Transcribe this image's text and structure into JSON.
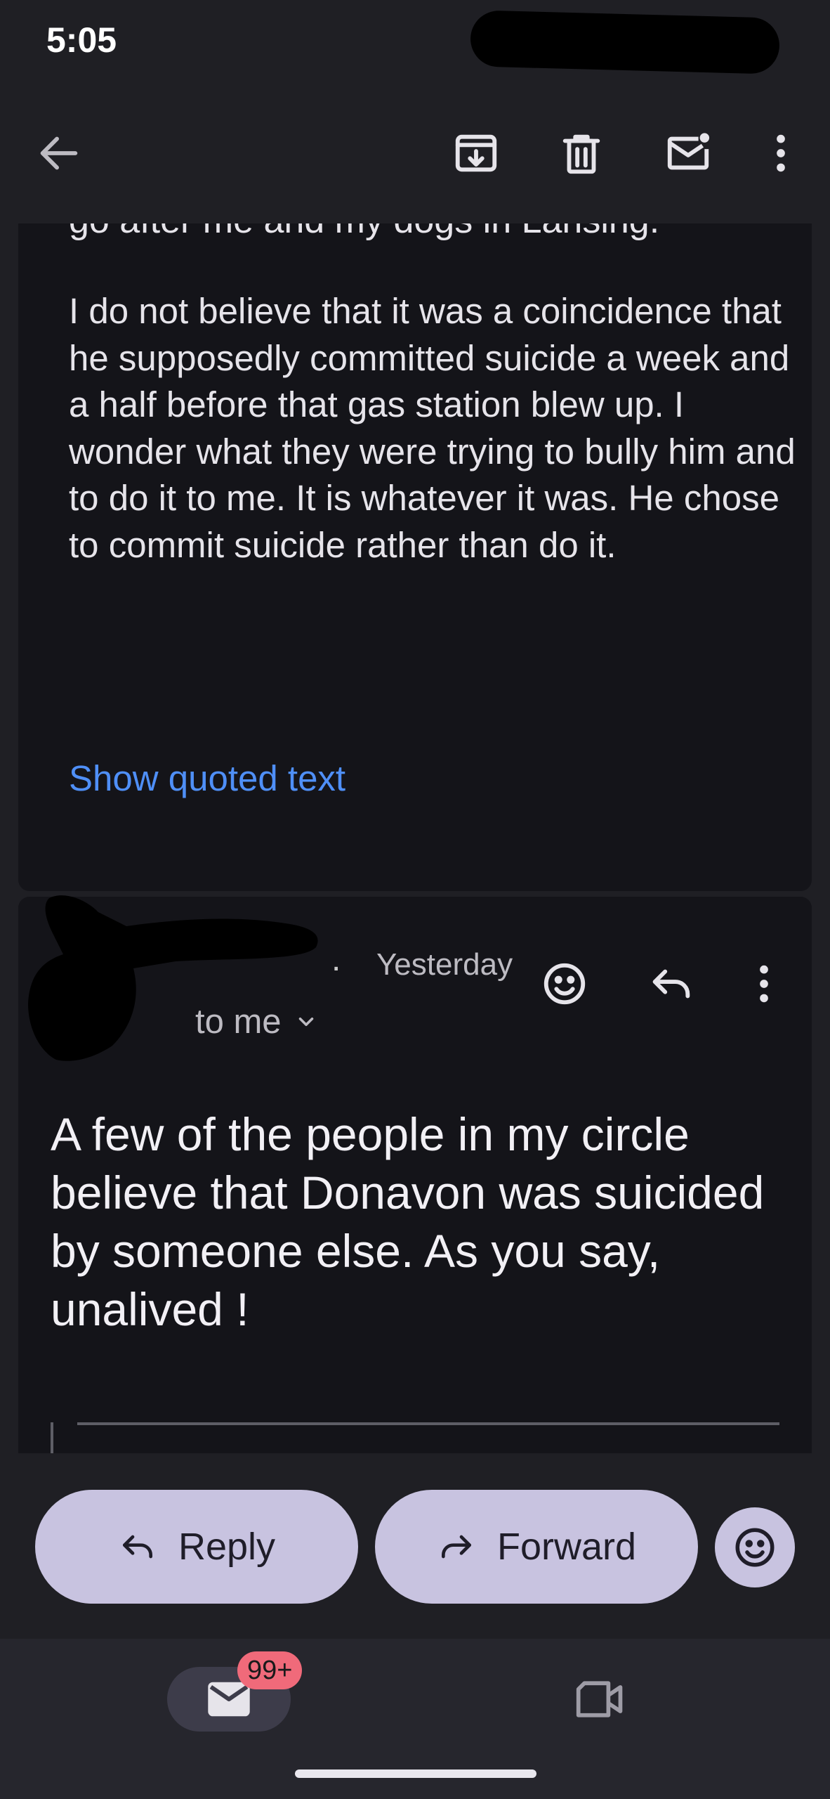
{
  "status_bar": {
    "time": "5:05"
  },
  "toolbar": {
    "back_icon": "arrow-left-icon",
    "archive_icon": "archive-icon",
    "delete_icon": "trash-icon",
    "mark_unread_icon": "mail-unread-icon",
    "more_icon": "more-vert-icon"
  },
  "first_message": {
    "cutoff_text": "go after me and my dogs in Lansing.",
    "body": "I do not believe that it was a coincidence that he supposedly committed suicide a week and a half before that gas station blew up. I wonder what they were trying to bully him and to do it to me. It is whatever it was. He chose to commit suicide rather than do it.",
    "show_quoted_label": "Show quoted text"
  },
  "second_message": {
    "sender_trailing": ".",
    "date": "Yesterday",
    "recipient": "to me",
    "body": "A few of the people in my circle believe that Donavon was suicided by someone else. As you say, unalived !"
  },
  "actions": {
    "reply_label": "Reply",
    "forward_label": "Forward"
  },
  "bottom_nav": {
    "mail_badge": "99+"
  },
  "colors": {
    "background": "#1f1f24",
    "card": "#141419",
    "link": "#4f8ff7",
    "pill": "#c8c3e0",
    "badge": "#f06a7a"
  }
}
